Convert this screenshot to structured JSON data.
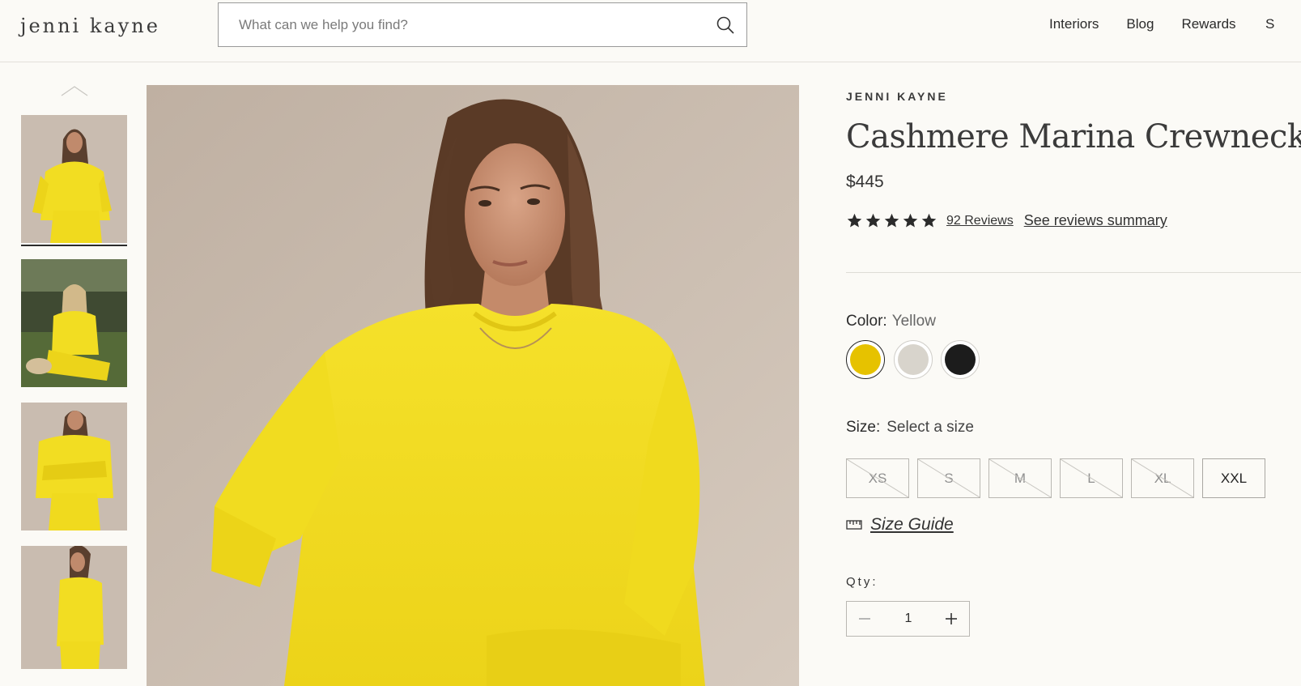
{
  "header": {
    "logo_text": "jenni kayne",
    "search_placeholder": "What can we help you find?",
    "nav": [
      "Interiors",
      "Blog",
      "Rewards"
    ],
    "nav_cut": "S"
  },
  "product": {
    "brand": "JENNI KAYNE",
    "title": "Cashmere Marina Crewneck",
    "price": "$445",
    "rating_stars": 5,
    "reviews_link": "92 Reviews",
    "summary_link": "See reviews summary",
    "color_label": "Color:",
    "color_value": "Yellow",
    "colors": [
      {
        "name": "Yellow",
        "hex": "#e6c200",
        "selected": true
      },
      {
        "name": "Oatmeal",
        "hex": "#d8d4cc",
        "selected": false
      },
      {
        "name": "Black",
        "hex": "#1c1c1c",
        "selected": false
      }
    ],
    "size_label": "Size:",
    "size_value": "Select a size",
    "sizes": [
      {
        "label": "XS",
        "available": false
      },
      {
        "label": "S",
        "available": false
      },
      {
        "label": "M",
        "available": false
      },
      {
        "label": "L",
        "available": false
      },
      {
        "label": "XL",
        "available": false
      },
      {
        "label": "XXL",
        "available": true
      }
    ],
    "size_guide": "Size Guide",
    "qty_label": "Qty:",
    "qty_value": "1"
  },
  "colors": {
    "background": "#fbfaf6",
    "sweater": "#f2dd22",
    "backdrop": "#cbbdb0"
  }
}
